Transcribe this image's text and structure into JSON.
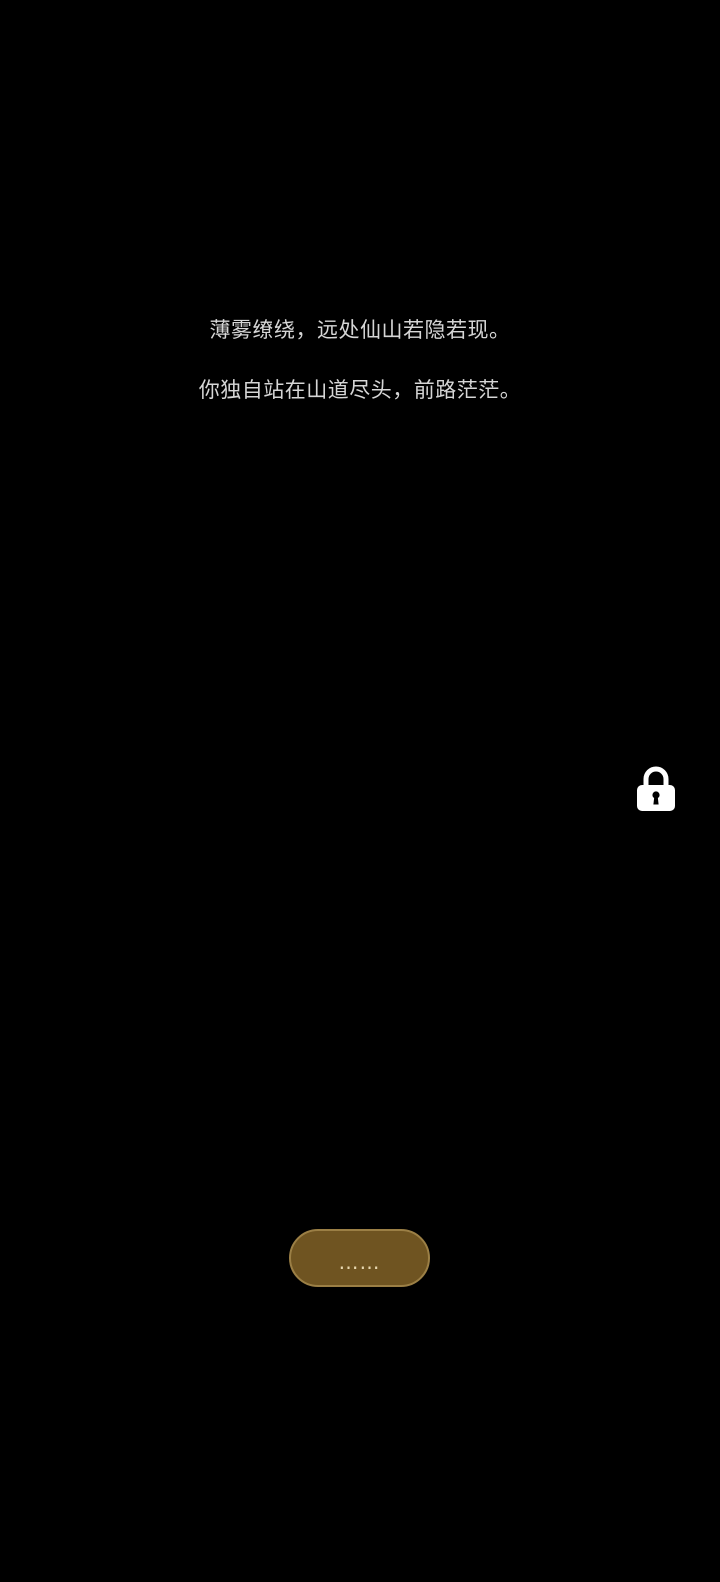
{
  "story": {
    "lines": [
      "薄雾缭绕，远处仙山若隐若现。",
      "你独自站在山道尽头，前路茫茫。"
    ]
  },
  "lock": {
    "icon": "lock-icon",
    "color": "#ffffff"
  },
  "continue_button": {
    "label": "……",
    "color": "#6f5421",
    "border_color": "#9b7f45"
  }
}
